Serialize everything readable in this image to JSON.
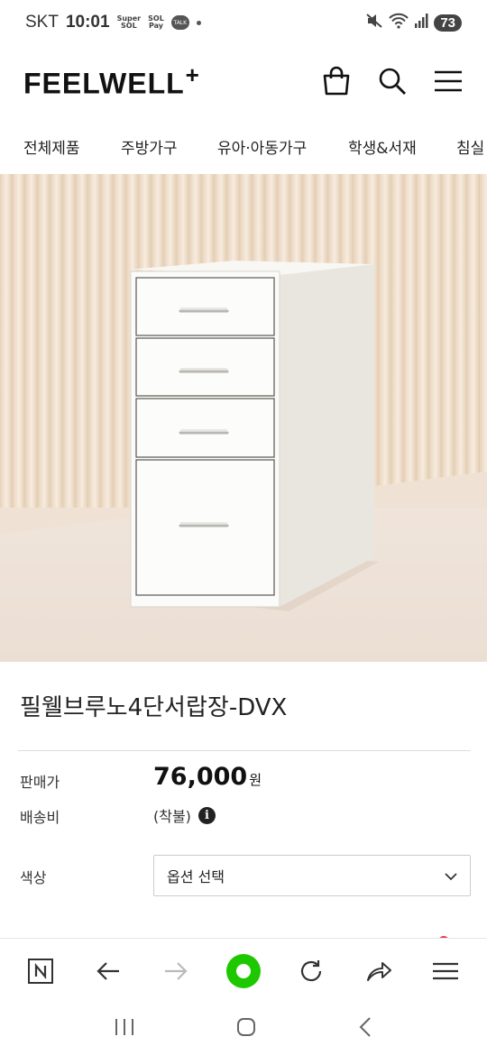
{
  "status_bar": {
    "carrier": "SKT",
    "time": "10:01",
    "battery": "73",
    "mini_icon_1": "Super SOL",
    "mini_icon_2": "SOL Pay",
    "talk": "TALK"
  },
  "header": {
    "logo": "FEELWELL",
    "logo_plus": "+",
    "icons": [
      "shopping-bag-icon",
      "search-icon",
      "menu-icon"
    ]
  },
  "categories": [
    "전체제품",
    "주방가구",
    "유아·아동가구",
    "학생&서재",
    "침실"
  ],
  "product": {
    "title": "필웰브루노4단서랍장-DVX",
    "price_label": "판매가",
    "price": "76,000",
    "price_unit": "원",
    "shipping_label": "배송비",
    "shipping_value": "(착불)",
    "color_label": "색상",
    "option_placeholder": "옵션 선택"
  },
  "browser_toolbar": {
    "icons": [
      "naver-n-icon",
      "back-arrow-icon",
      "forward-arrow-icon",
      "green-home-icon",
      "refresh-icon",
      "share-icon",
      "menu-icon"
    ],
    "accent_color": "#1ec800"
  },
  "android_nav": {
    "icons": [
      "recent-apps-icon",
      "home-icon",
      "back-icon"
    ]
  }
}
